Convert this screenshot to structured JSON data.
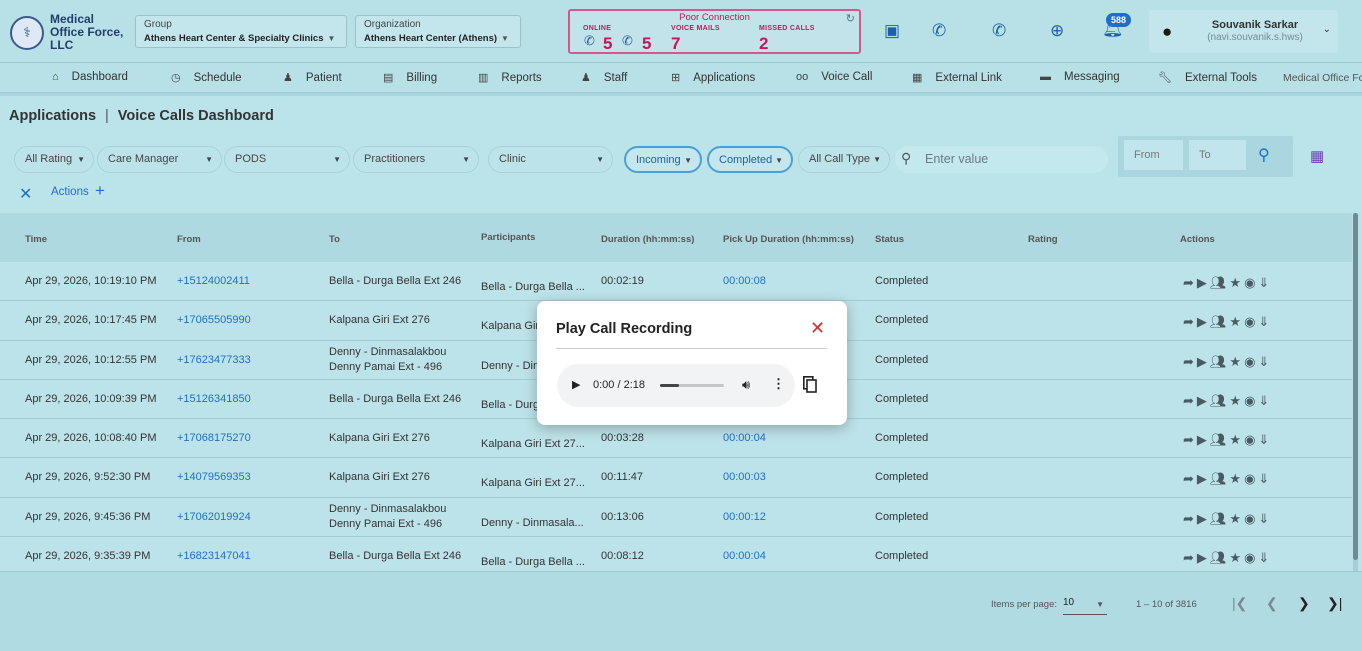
{
  "header": {
    "logo_text": "Medical Office Force, LLC",
    "group": {
      "label": "Group",
      "value": "Athens Heart Center & Specialty Clinics"
    },
    "organization": {
      "label": "Organization",
      "value": "Athens Heart Center (Athens)"
    },
    "connection": {
      "title": "Poor Connection",
      "online_label": "ONLINE",
      "online_count_1": "5",
      "online_count_2": "5",
      "voice_mails_label": "VOICE MAILS",
      "voice_mails_count": "7",
      "missed_calls_label": "MISSED CALLS",
      "missed_calls_count": "2"
    },
    "notification_count": "588",
    "user": {
      "name": "Souvanik Sarkar",
      "email": "(navi.souvanik.s.hws)"
    }
  },
  "nav": {
    "items": [
      {
        "label": "Dashboard",
        "icon": "home-icon"
      },
      {
        "label": "Schedule",
        "icon": "clock-icon"
      },
      {
        "label": "Patient",
        "icon": "patient-icon"
      },
      {
        "label": "Billing",
        "icon": "billing-icon"
      },
      {
        "label": "Reports",
        "icon": "document-icon"
      },
      {
        "label": "Staff",
        "icon": "staff-icon"
      },
      {
        "label": "Applications",
        "icon": "applications-icon"
      },
      {
        "label": "Voice Call",
        "icon": "voicemail-icon"
      },
      {
        "label": "External Link",
        "icon": "external-link-icon"
      },
      {
        "label": "Messaging",
        "icon": "message-icon"
      },
      {
        "label": "External Tools",
        "icon": "wrench-icon"
      },
      {
        "label": "Medical Office Fo",
        "icon": ""
      }
    ]
  },
  "breadcrumb": {
    "root": "Applications",
    "separator": "|",
    "current": "Voice Calls Dashboard"
  },
  "filters": {
    "rating": "All Rating",
    "care_manager": "Care Manager",
    "pods": "PODS",
    "practitioners": "Practitioners",
    "clinic": "Clinic",
    "direction": "Incoming",
    "status": "Completed",
    "call_type": "All Call Type",
    "search_placeholder": "Enter value",
    "from_placeholder": "From",
    "to_placeholder": "To"
  },
  "actions_label": "Actions",
  "table": {
    "columns": [
      "Time",
      "From",
      "To",
      "Participants",
      "Duration (hh:mm:ss)",
      "Pick Up Duration (hh:mm:ss)",
      "Status",
      "Rating",
      "Actions"
    ],
    "rows": [
      {
        "time": "Apr 29, 2026, 10:19:10 PM",
        "from": "+15124002411",
        "to": "Bella - Durga Bella Ext 246",
        "to2": "",
        "participants": "Bella - Durga Bella ...",
        "duration": "00:02:19",
        "pickup": "00:00:08",
        "status": "Completed"
      },
      {
        "time": "Apr 29, 2026, 10:17:45 PM",
        "from": "+17065505990",
        "to": "Kalpana Giri Ext 276",
        "to2": "",
        "participants": "Kalpana Giri",
        "duration": "",
        "pickup": "",
        "status": "Completed"
      },
      {
        "time": "Apr 29, 2026, 10:12:55 PM",
        "from": "+17623477333",
        "to": "Denny - Dinmasalakbou",
        "to2": "Denny Pamai Ext - 496",
        "participants": "Denny - Din",
        "duration": "",
        "pickup": "",
        "status": "Completed"
      },
      {
        "time": "Apr 29, 2026, 10:09:39 PM",
        "from": "+15126341850",
        "to": "Bella - Durga Bella Ext 246",
        "to2": "",
        "participants": "Bella - Durg",
        "duration": "",
        "pickup": "",
        "status": "Completed"
      },
      {
        "time": "Apr 29, 2026, 10:08:40 PM",
        "from": "+17068175270",
        "to": "Kalpana Giri Ext 276",
        "to2": "",
        "participants": "Kalpana Giri Ext 27...",
        "duration": "00:03:28",
        "pickup": "00:00:04",
        "status": "Completed"
      },
      {
        "time": "Apr 29, 2026, 9:52:30 PM",
        "from": "+14079569353",
        "to": "Kalpana Giri Ext 276",
        "to2": "",
        "participants": "Kalpana Giri Ext 27...",
        "duration": "00:11:47",
        "pickup": "00:00:03",
        "status": "Completed"
      },
      {
        "time": "Apr 29, 2026, 9:45:36 PM",
        "from": "+17062019924",
        "to": "Denny - Dinmasalakbou",
        "to2": "Denny Pamai Ext - 496",
        "participants": "Denny - Dinmasala...",
        "duration": "00:13:06",
        "pickup": "00:00:12",
        "status": "Completed"
      },
      {
        "time": "Apr 29, 2026, 9:35:39 PM",
        "from": "+16823147041",
        "to": "Bella - Durga Bella Ext 246",
        "to2": "",
        "participants": "Bella - Durga Bella ...",
        "duration": "00:08:12",
        "pickup": "00:00:04",
        "status": "Completed"
      }
    ]
  },
  "pagination": {
    "items_per_page_label": "Items per page:",
    "items_per_page": "10",
    "range": "1 – 10 of 3816"
  },
  "modal": {
    "title": "Play Call Recording",
    "audio_time": "0:00 / 2:18",
    "audio_progress": 0.3
  }
}
